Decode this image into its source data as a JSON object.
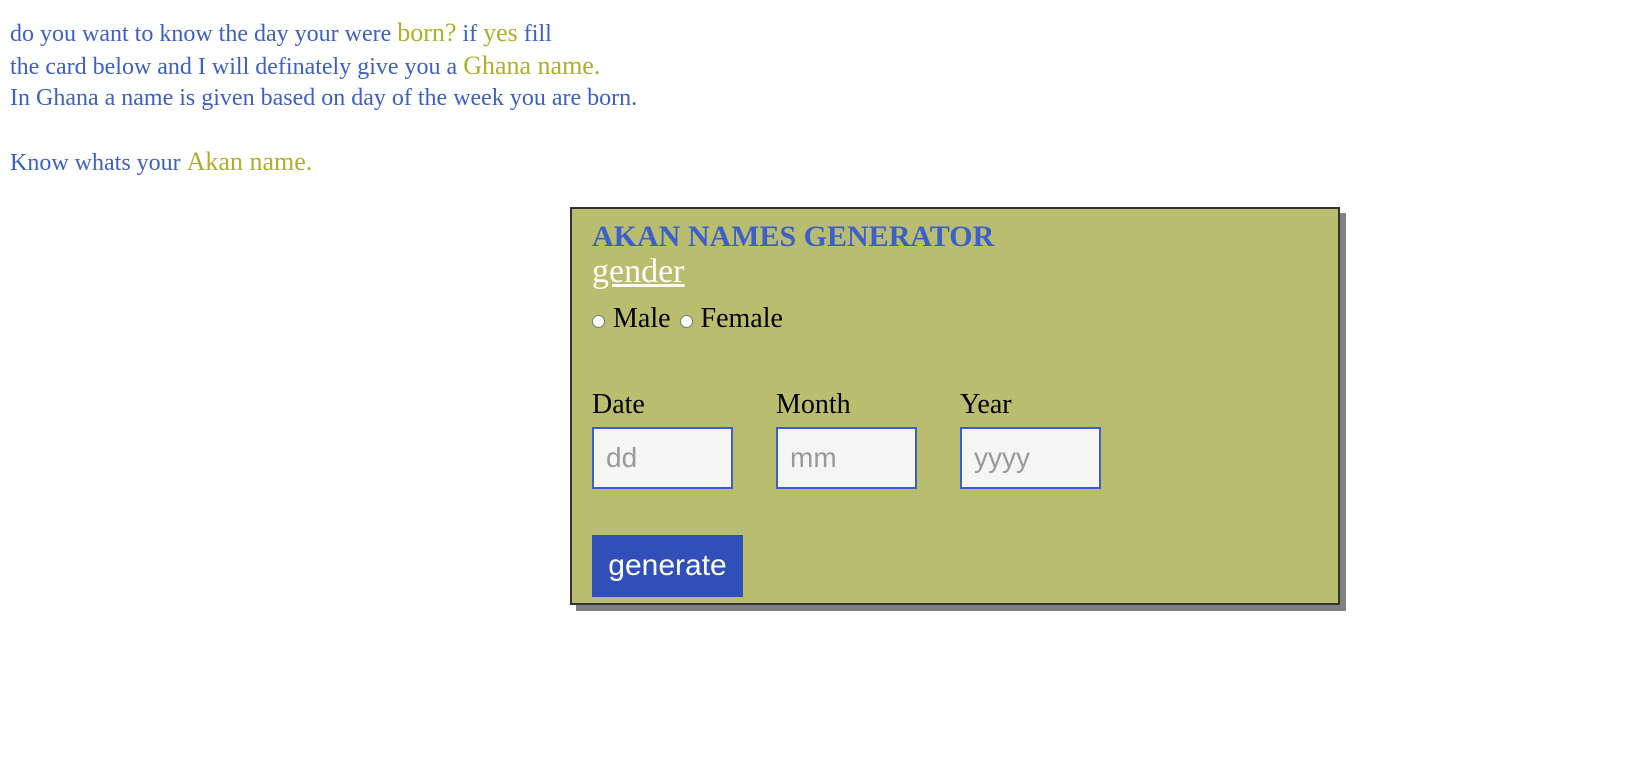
{
  "intro": {
    "line1": {
      "a": "do you want to know the day your were ",
      "b": "born?",
      "c": " if ",
      "d": "yes",
      "e": " fill"
    },
    "line2": {
      "a": "the card below and I will definately give you a ",
      "b": "Ghana name."
    },
    "line3": "In Ghana a name is given based on day of the week you are born.",
    "line4": {
      "a": "Know whats your ",
      "b": "Akan name."
    }
  },
  "card": {
    "title": "AKAN NAMES GENERATOR",
    "gender_label": "gender",
    "gender_options": [
      "Male",
      "Female"
    ],
    "date_label": "Date",
    "date_placeholder": "dd",
    "month_label": "Month",
    "month_placeholder": "mm",
    "year_label": "Year",
    "year_placeholder": "yyyy",
    "button_label": "generate"
  },
  "colors": {
    "text_blue": "#3c5fc9",
    "highlight": "#acb12a",
    "card_bg": "#b9be6f",
    "button_bg": "#304fb8"
  }
}
